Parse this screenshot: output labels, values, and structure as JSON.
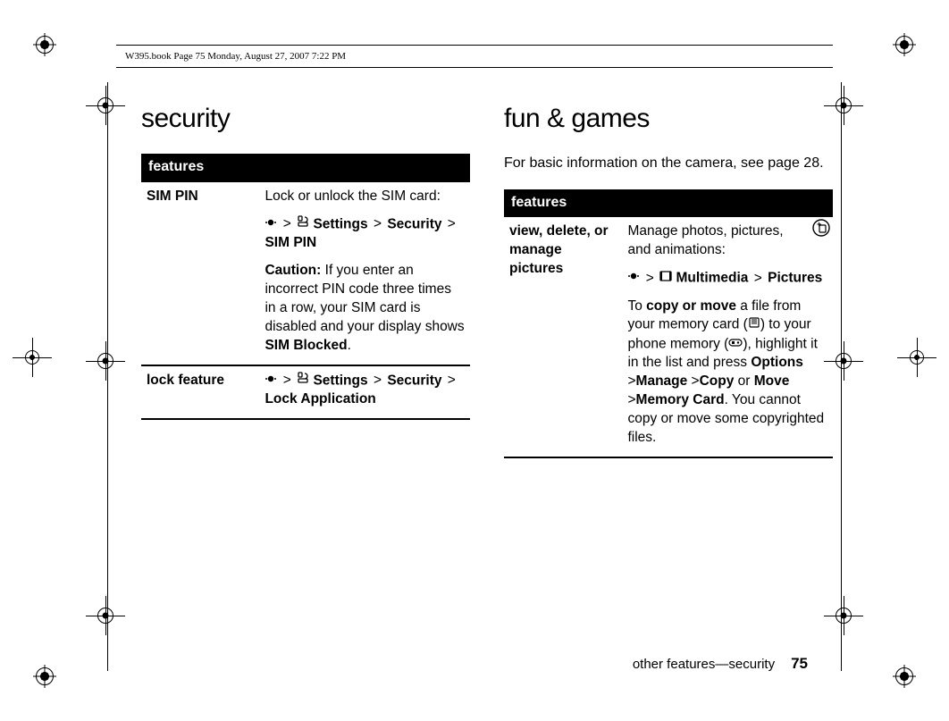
{
  "runhead": "W395.book  Page 75  Monday, August 27, 2007  7:22 PM",
  "left": {
    "heading": "security",
    "table_header": "features",
    "rows": [
      {
        "label": "SIM PIN",
        "p1": "Lock or unlock the SIM card:",
        "nav": {
          "settings": "Settings",
          "security": "Security",
          "simpin": "SIM PIN"
        },
        "caution_label": "Caution:",
        "caution_text": " If you enter an incorrect PIN code three times in a row, your SIM card is disabled and your display shows ",
        "caution_code": "SIM Blocked",
        "caution_end": "."
      },
      {
        "label": "lock feature",
        "nav": {
          "settings": "Settings",
          "security": "Security",
          "lockapp": "Lock Application"
        }
      }
    ]
  },
  "right": {
    "heading": "fun & games",
    "intro": "For basic information on the camera, see page 28.",
    "table_header": "features",
    "row": {
      "label": "view, delete, or manage pictures",
      "p1": "Manage photos, pictures, and animations:",
      "nav": {
        "mm": "Multimedia",
        "pics": "Pictures"
      },
      "p2a": "To ",
      "p2b": "copy or move",
      "p2c": " a file from your memory card (",
      "p2d": ") to your phone memory (",
      "p2e": "), highlight it in the list and press ",
      "opts": "Options",
      "manage": "Manage",
      "copy": "Copy",
      "or": " or ",
      "move": "Move",
      "mcard": "Memory Card",
      "tail": ". You cannot copy or move some copyrighted files."
    }
  },
  "footer": {
    "text": "other features—security",
    "page": "75"
  }
}
